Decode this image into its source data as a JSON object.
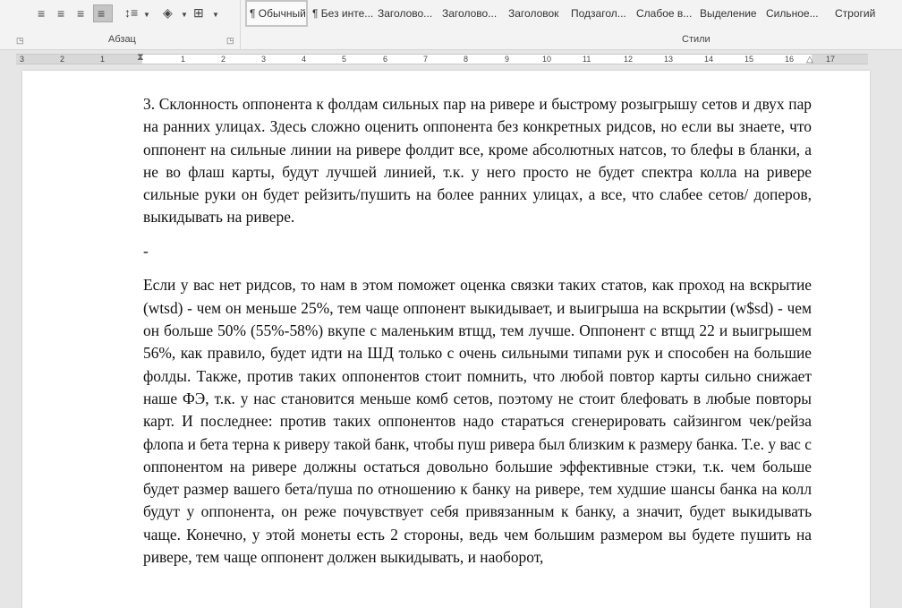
{
  "ribbon": {
    "paragraph_group_label": "Абзац",
    "styles_group_label": "Стили",
    "styles": [
      "¶ Обычный",
      "¶ Без инте...",
      "Заголово...",
      "Заголово...",
      "Заголовок",
      "Подзагол...",
      "Слабое в...",
      "Выделение",
      "Сильное...",
      "Строгий"
    ],
    "active_style_index": 0
  },
  "ruler": {
    "left_labels": [
      "3",
      "2",
      "1"
    ],
    "right_labels": [
      "1",
      "2",
      "3",
      "4",
      "5",
      "6",
      "7",
      "8",
      "9",
      "10",
      "11",
      "12",
      "13",
      "14",
      "15",
      "16",
      "17"
    ]
  },
  "document": {
    "paragraphs": [
      "3. Склонность оппонента к фолдам сильных пар на ривере и быстрому розыгрышу сетов и двух пар на ранних улицах. Здесь сложно оценить оппонента без конкретных ридсов, но если вы знаете, что оппонент на сильные линии на ривере фолдит все, кроме абсолютных натсов, то блефы в бланки, а не во флаш карты, будут лучшей линией, т.к. у него просто не будет спектра колла на ривере сильные руки он будет рейзить/пушить на более ранних улицах, а все, что слабее сетов/ доперов, выкидывать на ривере.",
      "-",
      "Если у вас нет ридсов, то нам в этом поможет оценка связки таких статов, как проход на вскрытие (wtsd) - чем он меньше 25%, тем чаще оппонент выкидывает, и выигрыша на вскрытии (w$sd) - чем он больше 50% (55%-58%) вкупе с маленьким втщд, тем лучше. Оппонент с втщд 22 и выигрышем 56%, как правило, будет идти на ШД только с очень сильными типами рук и способен на большие фолды. Также, против таких оппонентов стоит помнить, что любой повтор карты сильно снижает наше ФЭ, т.к. у нас становится меньше комб сетов, поэтому не стоит блефовать в любые повторы карт. И последнее: против таких оппонентов надо стараться сгенерировать сайзингом чек/рейза флопа и бета терна к риверу такой банк, чтобы пуш ривера был близким к размеру банка. Т.е. у вас с оппонентом на ривере должны остаться довольно большие эффективные стэки, т.к. чем больше будет размер вашего бета/пуша по отношению к банку на ривере, тем худшие шансы банка на колл будут у оппонента, он реже почувствует себя привязанным к банку, а значит, будет выкидывать чаще. Конечно, у этой монеты есть 2 стороны, ведь чем большим размером вы будете пушить на ривере, тем чаще оппонент должен выкидывать, и наоборот,"
    ]
  }
}
